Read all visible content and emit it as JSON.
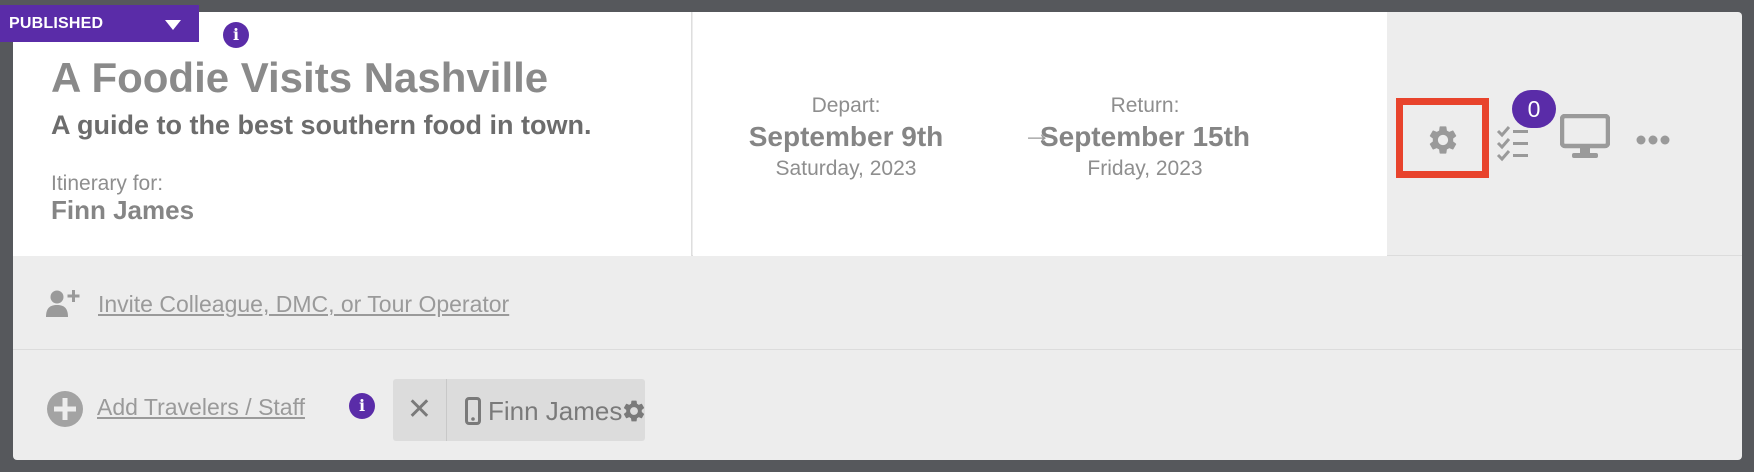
{
  "status": {
    "label": "PUBLISHED",
    "info": "i"
  },
  "trip": {
    "title": "A Foodie Visits Nashville",
    "subtitle": "A guide to the best southern food in town.",
    "itinerary_label": "Itinerary for:",
    "itinerary_name": "Finn James"
  },
  "dates": {
    "depart_label": "Depart:",
    "depart_date": "September 9th",
    "depart_day": "Saturday, 2023",
    "arrow": "→",
    "return_label": "Return:",
    "return_date": "September 15th",
    "return_day": "Friday, 2023"
  },
  "toolbar": {
    "tasks_count": "0",
    "icons": [
      "gear-icon",
      "tasks-icon",
      "monitor-icon",
      "more-icon"
    ],
    "highlight_color": "#e8432c"
  },
  "invite": {
    "label": " Invite Colleague, DMC, or Tour Operator"
  },
  "travelers": {
    "add_label": "Add Travelers / Staff",
    "info": "i",
    "chip": {
      "remove": "✕",
      "name": "Finn James"
    }
  },
  "colors": {
    "accent": "#5a2ca8",
    "panel": "#ffffff",
    "background": "#ededed",
    "frame": "#56585c"
  }
}
